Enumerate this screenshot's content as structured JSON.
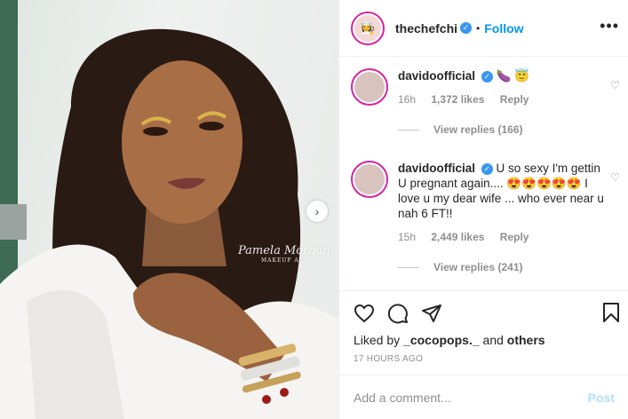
{
  "post": {
    "author": "thechefchi",
    "follow_label": "Follow",
    "separator": "•",
    "more_icon": "more-horizontal-icon",
    "next_icon": "chevron-right-icon",
    "watermark": {
      "line1": "Pamela Morgan",
      "line2": "MAKEUP ARTIST"
    }
  },
  "comments": [
    {
      "user": "davidoofficial",
      "text": "🍆 😇",
      "time": "16h",
      "likes": "1,372 likes",
      "reply_label": "Reply",
      "view_replies": "View replies (166)"
    },
    {
      "user": "davidoofficial",
      "text": "U so sexy I'm gettin U pregnant again.... 😍😍😍😍😍 I love u my dear wife ... who ever near u nah 6 FT!!",
      "time": "15h",
      "likes": "2,449 likes",
      "reply_label": "Reply",
      "view_replies": "View replies (241)"
    }
  ],
  "actions": {
    "liked_prefix": "Liked by ",
    "liked_user": "_cocopops._",
    "liked_and": " and ",
    "liked_others": "others",
    "timestamp": "17 HOURS AGO"
  },
  "composer": {
    "placeholder": "Add a comment...",
    "post_label": "Post"
  },
  "colors": {
    "accent": "#0095f6",
    "verified": "#3897f0",
    "story_ring": "#d6249f"
  }
}
